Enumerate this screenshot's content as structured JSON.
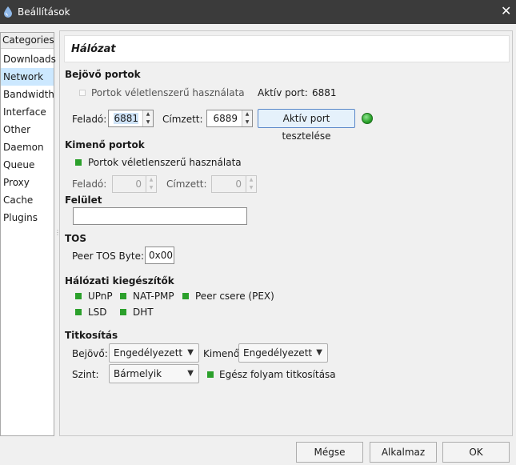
{
  "window": {
    "title": "Beállítások",
    "close_glyph": "✕",
    "icon": "droplet-icon"
  },
  "sidebar": {
    "header": "Categories",
    "items": [
      {
        "label": "Downloads"
      },
      {
        "label": "Network",
        "selected": true
      },
      {
        "label": "Bandwidth"
      },
      {
        "label": "Interface"
      },
      {
        "label": "Other"
      },
      {
        "label": "Daemon"
      },
      {
        "label": "Queue"
      },
      {
        "label": "Proxy"
      },
      {
        "label": "Cache"
      },
      {
        "label": "Plugins"
      }
    ]
  },
  "page": {
    "title": "Hálózat"
  },
  "incoming": {
    "heading": "Bejövő portok",
    "random_label": "Portok véletlenszerű használata",
    "random_checked": false,
    "active_port_label": "Aktív port:",
    "active_port_value": "6881",
    "from_label": "Feladó:",
    "from_value": "6881",
    "to_label": "Címzett:",
    "to_value": "6889",
    "test_button": "Aktív port tesztelése",
    "status_color": "#2aa22a"
  },
  "outgoing": {
    "heading": "Kimenő portok",
    "random_label": "Portok véletlenszerű használata",
    "random_checked": true,
    "from_label": "Feladó:",
    "from_value": "0",
    "to_label": "Címzett:",
    "to_value": "0"
  },
  "interface": {
    "heading": "Felület",
    "value": ""
  },
  "tos": {
    "heading": "TOS",
    "label": "Peer TOS Byte:",
    "value": "0x00"
  },
  "extensions": {
    "heading": "Hálózati kiegészítők",
    "items": [
      {
        "label": "UPnP",
        "checked": true
      },
      {
        "label": "NAT-PMP",
        "checked": true
      },
      {
        "label": "Peer csere (PEX)",
        "checked": true
      },
      {
        "label": "LSD",
        "checked": true
      },
      {
        "label": "DHT",
        "checked": true
      }
    ]
  },
  "encryption": {
    "heading": "Titkosítás",
    "in_label": "Bejövő:",
    "in_value": "Engedélyezett",
    "out_label": "Kimenő:",
    "out_value": "Engedélyezett",
    "level_label": "Szint:",
    "level_value": "Bármelyik",
    "full_stream_label": "Egész folyam titkosítása",
    "full_stream_checked": true
  },
  "footer": {
    "cancel": "Mégse",
    "apply": "Alkalmaz",
    "ok": "OK"
  },
  "colors": {
    "titlebar": "#3b3b3b",
    "selection": "#cce8ff",
    "checkbox_on": "#2ba02b"
  }
}
